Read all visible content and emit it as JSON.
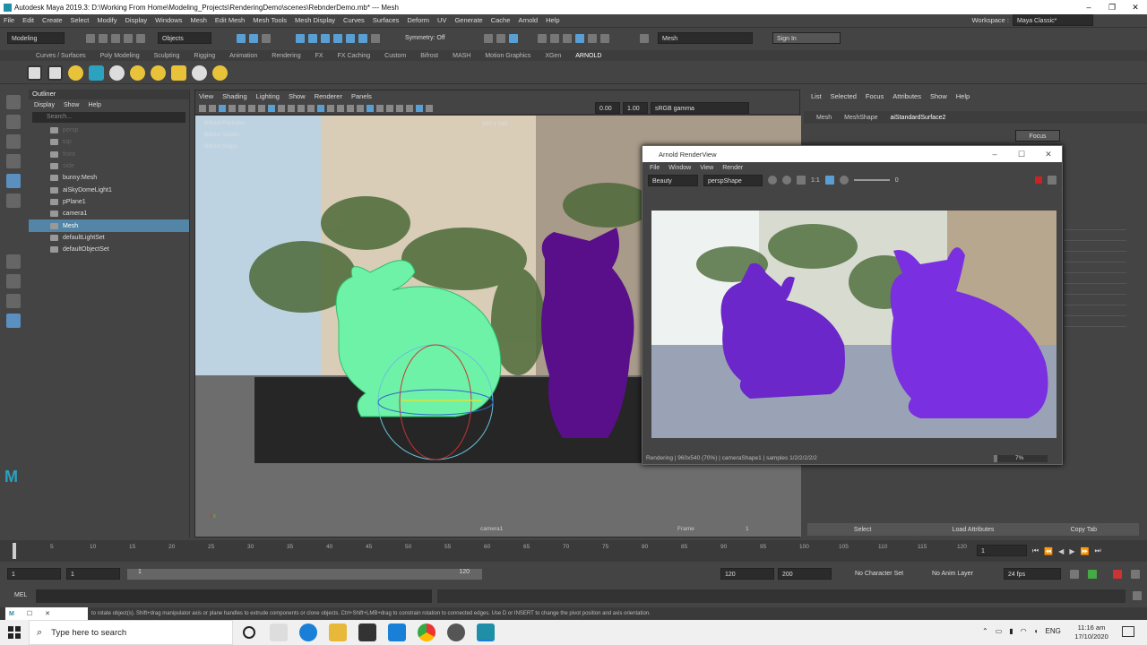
{
  "window": {
    "title": "Autodesk Maya 2019.3: D:\\Working From Home\\Modeling_Projects\\RenderingDemo\\scenes\\RebnderDemo.mb*  ---  Mesh"
  },
  "menubar": {
    "items": [
      "File",
      "Edit",
      "Create",
      "Select",
      "Modify",
      "Display",
      "Windows",
      "Mesh",
      "Edit Mesh",
      "Mesh Tools",
      "Mesh Display",
      "Curves",
      "Surfaces",
      "Deform",
      "UV",
      "Generate",
      "Cache",
      "Arnold",
      "Help"
    ],
    "workspace_label": "Workspace :",
    "workspace_value": "Maya Classic*"
  },
  "statusline": {
    "mode": "Modeling",
    "objects": "Objects",
    "symmetry": "Symmetry: Off",
    "search": "Mesh",
    "signin": "Sign In"
  },
  "shelf": {
    "tabs": [
      "Curves / Surfaces",
      "Poly Modeling",
      "Sculpting",
      "Rigging",
      "Animation",
      "Rendering",
      "FX",
      "FX Caching",
      "Custom",
      "Bifrost",
      "MASH",
      "Motion Graphics",
      "XGen",
      "ARNOLD"
    ]
  },
  "outliner": {
    "title": "Outliner",
    "menu": [
      "Display",
      "Show",
      "Help"
    ],
    "search": "Search...",
    "items": [
      {
        "label": "persp",
        "dim": true
      },
      {
        "label": "top",
        "dim": true
      },
      {
        "label": "front",
        "dim": true
      },
      {
        "label": "side",
        "dim": true
      },
      {
        "label": "bunny:Mesh",
        "dim": false
      },
      {
        "label": "aiSkyDomeLight1",
        "dim": false
      },
      {
        "label": "pPlane1",
        "dim": false
      },
      {
        "label": "camera1",
        "dim": false
      },
      {
        "label": "Mesh",
        "dim": false,
        "selected": true
      },
      {
        "label": "defaultLightSet",
        "dim": false
      },
      {
        "label": "defaultObjectSet",
        "dim": false
      }
    ]
  },
  "viewport": {
    "menu": [
      "View",
      "Shading",
      "Lighting",
      "Show",
      "Renderer",
      "Panels"
    ],
    "val1": "0.00",
    "val2": "1.00",
    "colorspace": "sRGB gamma",
    "resolution": "960 x 540",
    "hud": [
      "Bifrost Particles",
      "Bifrost Voxels",
      "Bifrost Steps"
    ],
    "camera": "camera1",
    "frame_label": "Frame",
    "frame_value": "1"
  },
  "attr": {
    "menu": [
      "List",
      "Selected",
      "Focus",
      "Attributes",
      "Show",
      "Help"
    ],
    "tabs": [
      "Mesh",
      "MeshShape",
      "aiStandardSurface2"
    ],
    "focus": "Focus",
    "buttons": [
      "Select",
      "Load Attributes",
      "Copy Tab"
    ]
  },
  "renderview": {
    "title": "Arnold RenderView",
    "menu": [
      "File",
      "Window",
      "View",
      "Render"
    ],
    "aov": "Beauty",
    "camera": "perspShape",
    "ratio": "1:1",
    "exposure": "0",
    "status": "Rendering | 960x540 (70%) | cameraShape1 | samples 1/2/2/2/2/2",
    "progress": "7%"
  },
  "timeline": {
    "ticks": [
      "1",
      "5",
      "10",
      "15",
      "20",
      "25",
      "30",
      "35",
      "40",
      "45",
      "50",
      "55",
      "60",
      "65",
      "70",
      "75",
      "80",
      "85",
      "90",
      "95",
      "100",
      "105",
      "110",
      "115",
      "120"
    ],
    "current": "1"
  },
  "range": {
    "start": "1",
    "start2": "1",
    "slider_start": "1",
    "slider_end": "120",
    "end": "120",
    "end2": "200",
    "character": "No Character Set",
    "anim": "No Anim Layer",
    "fps": "24 fps"
  },
  "mel": {
    "label": "MEL"
  },
  "help": {
    "text": "to rotate object(s). Shift+drag manipulator axis or plane handles to extrude components or clone objects. Ctrl+Shift+LMB+drag to constrain rotation to connected edges. Use D or INSERT to change the pivot position and axis orientation."
  },
  "taskbar": {
    "search": "Type here to search",
    "time": "11:16 am",
    "date": "17/10/2020",
    "lang": "ENG"
  }
}
